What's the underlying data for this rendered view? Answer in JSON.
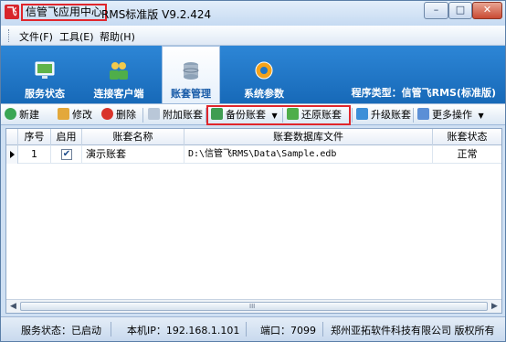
{
  "window": {
    "brand": "信管飞应用中心",
    "title": "RMS标准版 V9.2.424",
    "minimize": "–",
    "maximize": "□",
    "close": "✕"
  },
  "menu": [
    {
      "label": "文件(F)"
    },
    {
      "label": "工具(E)"
    },
    {
      "label": "帮助(H)"
    }
  ],
  "nav": [
    {
      "label": "服务状态",
      "icon": "monitor-icon"
    },
    {
      "label": "连接客户端",
      "icon": "users-icon"
    },
    {
      "label": "账套管理",
      "icon": "database-icon",
      "active": true
    },
    {
      "label": "系统参数",
      "icon": "gear-icon"
    }
  ],
  "program_type": "程序类型：信管飞RMS(标准版)",
  "toolbar": {
    "new": "新建",
    "edit": "修改",
    "delete": "删除",
    "attach": "附加账套",
    "backup": "备份账套",
    "restore": "还原账套",
    "upgrade": "升级账套",
    "more": "更多操作",
    "dropdown_arrow": "▼"
  },
  "grid": {
    "columns": [
      "序号",
      "启用",
      "账套名称",
      "账套数据库文件",
      "账套状态"
    ],
    "rows": [
      {
        "index": "1",
        "enabled": "✔",
        "name": "演示账套",
        "file": "D:\\信管飞RMS\\Data\\Sample.edb",
        "status": "正常"
      }
    ]
  },
  "scrollbar": {
    "left": "◀",
    "right": "▶",
    "grip": "III"
  },
  "status": {
    "service": "服务状态：已启动",
    "ip": "本机IP：192.168.1.101",
    "port": "端口：7099",
    "copyright": "郑州亚拓软件科技有限公司 版权所有"
  },
  "colors": {
    "nav_blue": "#1f76c8",
    "highlight_red": "#e0262c"
  }
}
